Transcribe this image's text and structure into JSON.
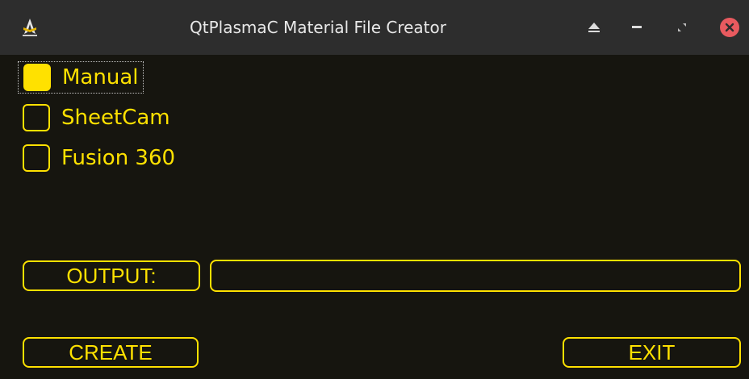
{
  "window": {
    "title": "QtPlasmaC Material File Creator",
    "app_icon": "linuxcnc-icon",
    "controls": [
      "keep-above-icon",
      "minimize-icon",
      "maximize-icon",
      "close-icon"
    ]
  },
  "options": [
    {
      "id": "manual",
      "label": "Manual",
      "checked": true,
      "focused": true
    },
    {
      "id": "sheetcam",
      "label": "SheetCam",
      "checked": false
    },
    {
      "id": "fusion",
      "label": "Fusion 360",
      "checked": false
    }
  ],
  "output": {
    "label": "OUTPUT:",
    "value": ""
  },
  "buttons": {
    "create": "CREATE",
    "exit": "EXIT"
  },
  "colors": {
    "accent": "#ffe100",
    "background": "#16150f",
    "titlebar": "#2d2d2d",
    "close": "#e85a5f"
  }
}
